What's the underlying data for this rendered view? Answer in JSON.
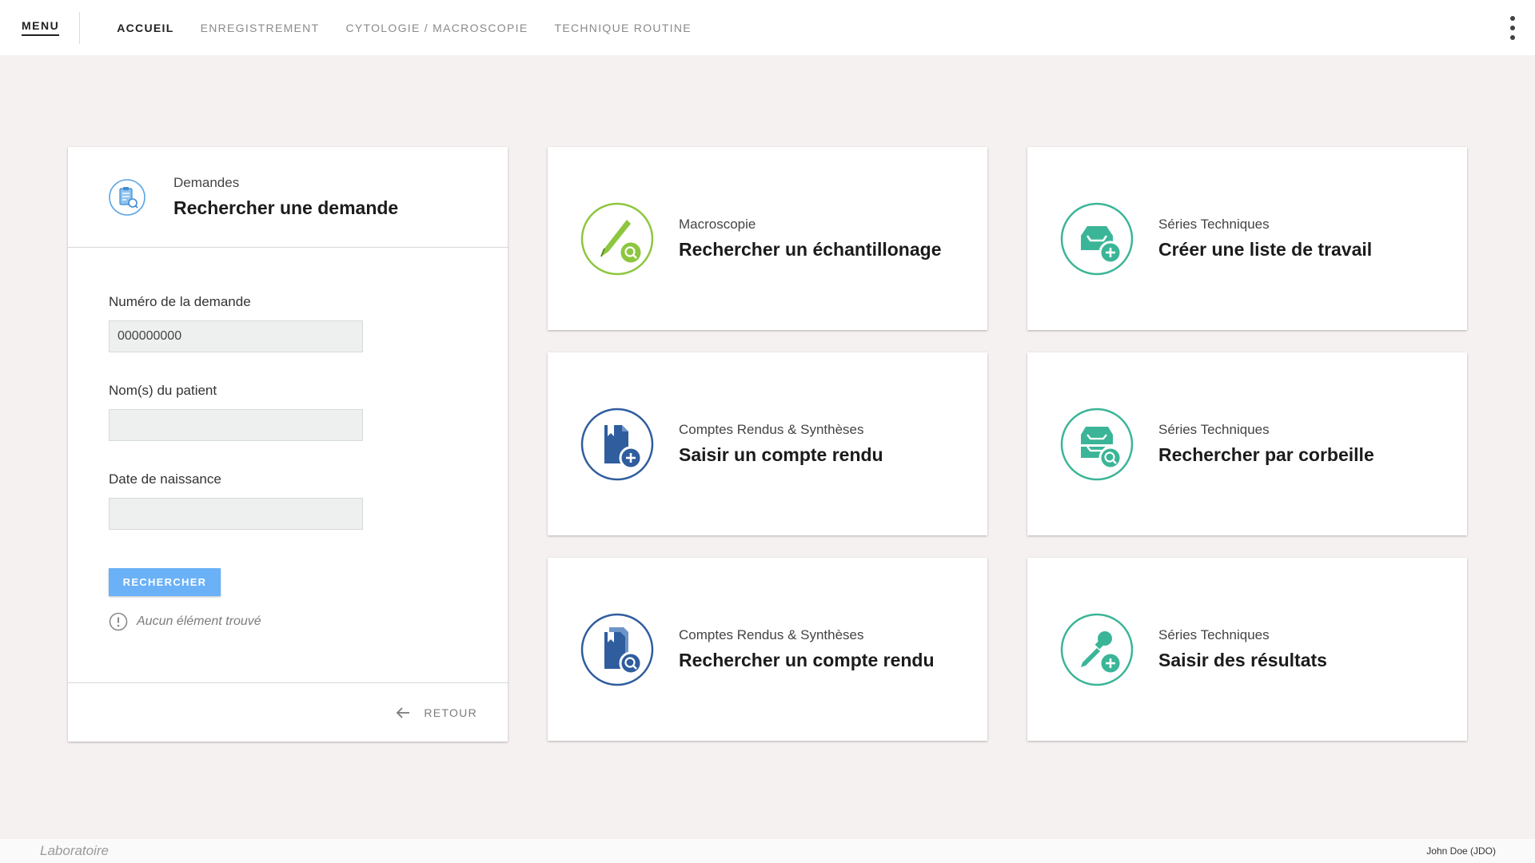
{
  "topbar": {
    "menu_label": "MENU",
    "nav": [
      {
        "label": "ACCUEIL",
        "active": true
      },
      {
        "label": "ENREGISTREMENT",
        "active": false
      },
      {
        "label": "CYTOLOGIE / MACROSCOPIE",
        "active": false
      },
      {
        "label": "TECHNIQUE ROUTINE",
        "active": false
      }
    ],
    "more_icon": "kebab-menu-icon"
  },
  "search_card": {
    "icon": "clipboard-search-icon",
    "category": "Demandes",
    "title": "Rechercher une demande",
    "fields": {
      "request_number": {
        "label": "Numéro de la demande",
        "value": "000000000",
        "placeholder": ""
      },
      "patient_name": {
        "label": "Nom(s) du patient",
        "value": "",
        "placeholder": ""
      },
      "birth_date": {
        "label": "Date de naissance",
        "value": "",
        "placeholder": ""
      }
    },
    "search_button": "RECHERCHER",
    "empty_message": "Aucun élément trouvé",
    "back_label": "RETOUR"
  },
  "tiles": [
    {
      "category": "Macroscopie",
      "title": "Rechercher un échantillonage",
      "icon": "scalpel-search-icon",
      "color": "#8dc63f"
    },
    {
      "category": "Séries Techniques",
      "title": "Créer une liste de travail",
      "icon": "inbox-add-icon",
      "color": "#3bb597"
    },
    {
      "category": "Comptes Rendus & Synthèses",
      "title": "Saisir un compte rendu",
      "icon": "document-add-icon",
      "color": "#2f5d9e"
    },
    {
      "category": "Séries Techniques",
      "title": "Rechercher par corbeille",
      "icon": "inbox-search-icon",
      "color": "#3bb597"
    },
    {
      "category": "Comptes Rendus & Synthèses",
      "title": "Rechercher un compte rendu",
      "icon": "document-search-icon",
      "color": "#2f5d9e"
    },
    {
      "category": "Séries Techniques",
      "title": "Saisir des résultats",
      "icon": "pipette-add-icon",
      "color": "#3bb597"
    }
  ],
  "footer": {
    "left": "Laboratoire",
    "user": "John Doe (JDO)"
  },
  "colors": {
    "background": "#f6f1f1",
    "primary_button": "#6ab1f8",
    "green": "#8dc63f",
    "teal": "#3bb597",
    "blue": "#2f5d9e"
  }
}
